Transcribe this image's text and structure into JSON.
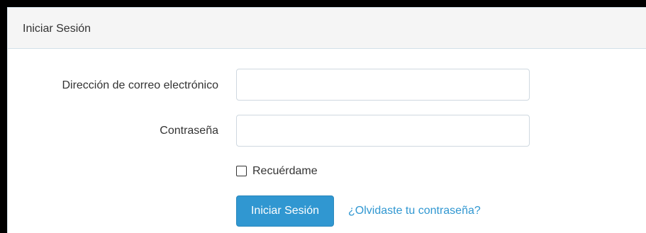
{
  "panel": {
    "title": "Iniciar Sesión"
  },
  "form": {
    "email_label": "Dirección de correo electrónico",
    "email_value": "",
    "password_label": "Contraseña",
    "password_value": "",
    "remember_label": "Recuérdame",
    "remember_checked": false,
    "submit_label": "Iniciar Sesión",
    "forgot_link": "¿Olvidaste tu contraseña?"
  },
  "colors": {
    "accent": "#3097d1",
    "header_bg": "#f5f5f5",
    "text": "#333333",
    "frame": "#000000"
  }
}
